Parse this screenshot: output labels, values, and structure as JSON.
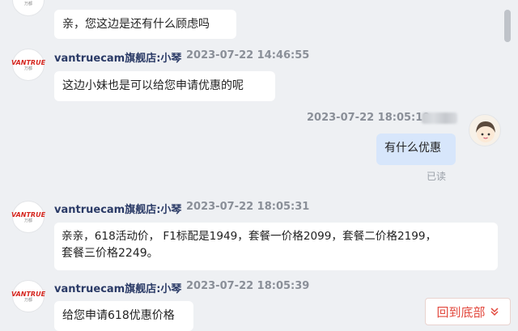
{
  "brand_logo": {
    "main": "VANTRUE",
    "sub": "万都"
  },
  "messages": [
    {
      "text": "亲，您这边是还有什么顾虑吗"
    },
    {
      "sender": "vantruecam旗舰店:小琴",
      "time": "2023-07-22 14:46:55",
      "text": "这边小妹也是可以给您申请优惠的呢"
    },
    {
      "time": "2023-07-22 18:05:19",
      "text": "有什么优惠",
      "status": "已读"
    },
    {
      "sender": "vantruecam旗舰店:小琴",
      "time": "2023-07-22 18:05:31",
      "text_line1": "亲亲，618活动价， F1标配是1949，套餐一价格2099，套餐二价格2199，",
      "text_line2": "套餐三价格2249。"
    },
    {
      "sender": "vantruecam旗舰店:小琴",
      "time": "2023-07-22 18:05:39",
      "text": "给您申请618优惠价格"
    }
  ],
  "back_to_bottom": {
    "label": "回到底部",
    "icon": "double-chevron-down-icon"
  },
  "colors": {
    "accent": "#e2483d",
    "mine_bubble": "#d7e6fb",
    "sender": "#2a3a66"
  }
}
